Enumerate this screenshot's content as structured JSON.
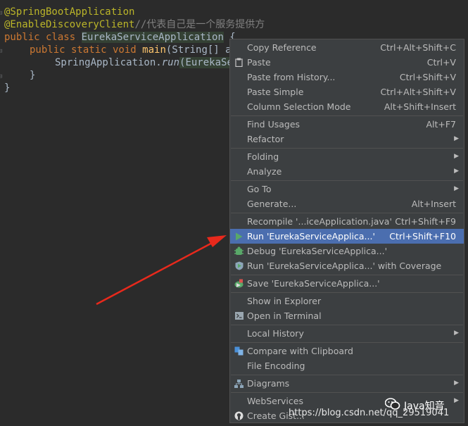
{
  "editor": {
    "lines": [
      {
        "ann": "@SpringBootApplication"
      },
      {
        "ann": "@EnableDiscoveryClient",
        "comment": "//代表自己是一个服务提供方"
      },
      {
        "kw": "public class ",
        "name": "EurekaServiceApplication",
        "rest": " {"
      },
      {
        "kw": "public static void ",
        "fn": "main",
        "rest": "(String[] args) {"
      },
      {
        "cls": "SpringApplication.",
        "call": "run",
        "arg": "(EurekaServiceApplication.class, args);"
      },
      {
        "text": "}"
      },
      {
        "text": "}"
      }
    ]
  },
  "menu": {
    "items": [
      {
        "label": "Copy Reference",
        "shortcut": "Ctrl+Alt+Shift+C"
      },
      {
        "label": "Paste",
        "shortcut": "Ctrl+V",
        "icon": "clipboard-icon"
      },
      {
        "label": "Paste from History...",
        "shortcut": "Ctrl+Shift+V"
      },
      {
        "label": "Paste Simple",
        "shortcut": "Ctrl+Alt+Shift+V"
      },
      {
        "label": "Column Selection Mode",
        "shortcut": "Alt+Shift+Insert"
      },
      {
        "label": "Find Usages",
        "shortcut": "Alt+F7"
      },
      {
        "label": "Refactor",
        "submenu": true
      },
      {
        "label": "Folding",
        "submenu": true
      },
      {
        "label": "Analyze",
        "submenu": true
      },
      {
        "label": "Go To",
        "submenu": true
      },
      {
        "label": "Generate...",
        "shortcut": "Alt+Insert"
      },
      {
        "label": "Recompile '...iceApplication.java'",
        "shortcut": "Ctrl+Shift+F9"
      },
      {
        "label": "Run 'EurekaServiceApplica...'",
        "shortcut": "Ctrl+Shift+F10",
        "icon": "run-icon",
        "selected": true
      },
      {
        "label": "Debug 'EurekaServiceApplica...'",
        "icon": "debug-icon"
      },
      {
        "label": "Run 'EurekaServiceApplica...' with Coverage",
        "icon": "coverage-icon"
      },
      {
        "label": "Save 'EurekaServiceApplica...'",
        "icon": "save-config-icon"
      },
      {
        "label": "Show in Explorer"
      },
      {
        "label": "Open in Terminal",
        "icon": "terminal-icon"
      },
      {
        "label": "Local History",
        "submenu": true
      },
      {
        "label": "Compare with Clipboard",
        "icon": "compare-icon"
      },
      {
        "label": "File Encoding"
      },
      {
        "label": "Diagrams",
        "submenu": true,
        "icon": "diagram-icon"
      },
      {
        "label": "WebServices",
        "submenu": true
      },
      {
        "label": "Create Gist...",
        "icon": "github-icon"
      }
    ]
  },
  "watermark": {
    "name": "Java知音",
    "url": "https://blog.csdn.net/qq_29519041"
  },
  "colors": {
    "background": "#2b2b2b",
    "menu": "#3c3f41",
    "selection": "#4b6eaf",
    "arrow": "#e8291c",
    "run_green": "#499c54"
  }
}
